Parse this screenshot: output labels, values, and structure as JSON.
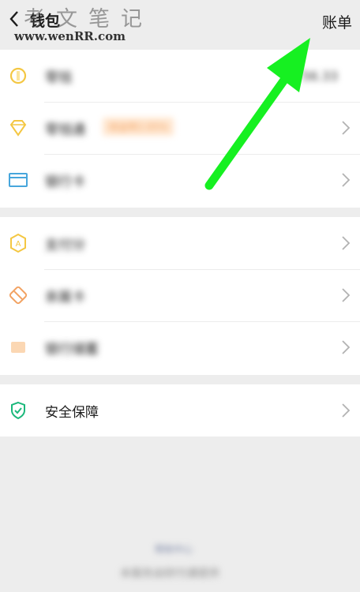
{
  "watermark": {
    "title": "考文笔记",
    "url": "www.wenRR.com"
  },
  "header": {
    "back_icon": "chevron-left-icon",
    "title": "钱包",
    "bill_label": "账单"
  },
  "groups": [
    {
      "items": [
        {
          "icon": "coin-icon",
          "label": "零钱",
          "value": "56.33",
          "blurred": true
        },
        {
          "icon": "diamond-icon",
          "label": "零钱通",
          "badge": "收益率2.05%",
          "blurred": true
        },
        {
          "icon": "card-icon",
          "label": "银行卡",
          "blurred": true
        }
      ]
    },
    {
      "items": [
        {
          "icon": "score-icon",
          "label": "支付分",
          "blurred": true
        },
        {
          "icon": "ticket-icon",
          "label": "亲属卡",
          "blurred": true
        },
        {
          "icon": "bank-icon",
          "label": "银行储蓄",
          "blurred": true
        }
      ]
    },
    {
      "items": [
        {
          "icon": "shield-check-icon",
          "label": "安全保障",
          "blurred": false
        }
      ]
    }
  ],
  "footer": {
    "help_link": "帮助中心",
    "note": "本服务由财付通提供"
  },
  "colors": {
    "background": "#ededed",
    "row_bg": "#ffffff",
    "accent_yellow": "#f4c743",
    "accent_blue": "#47a6dc",
    "accent_orange": "#f2a262",
    "accent_green": "#1bb87b",
    "arrow_green": "#16f021"
  }
}
